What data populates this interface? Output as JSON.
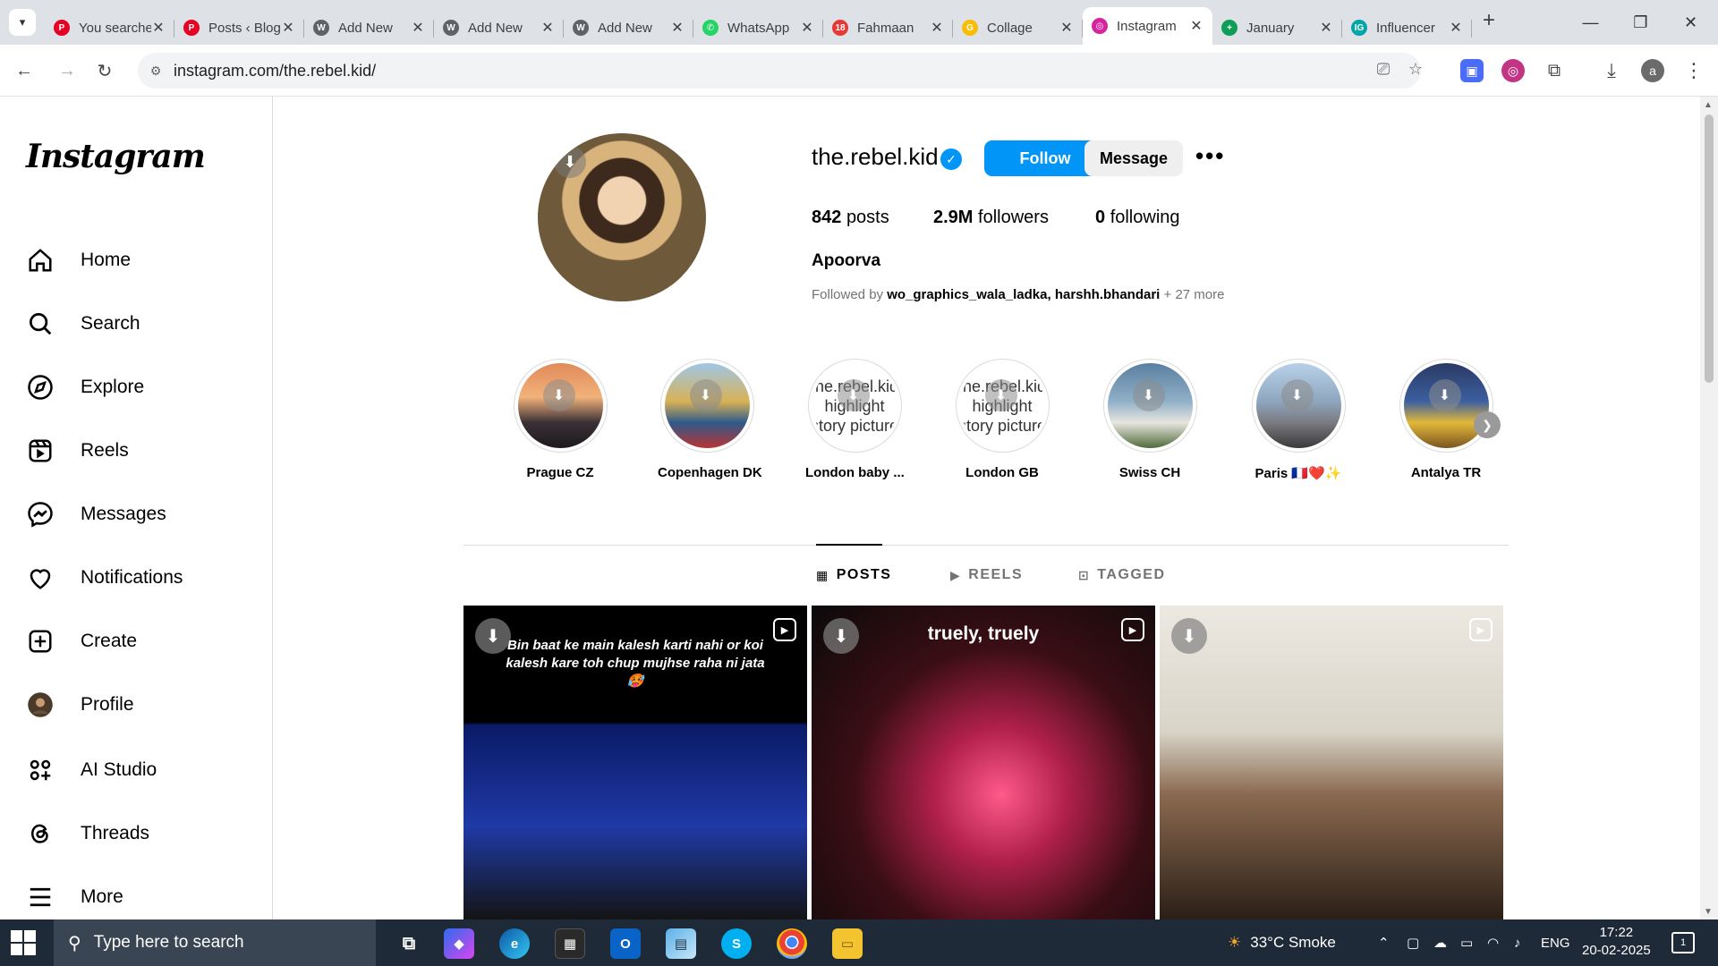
{
  "browser": {
    "tabs": [
      {
        "title": "You searched",
        "fav_color": "#e60023",
        "fav_char": "P"
      },
      {
        "title": "Posts ‹ Blog",
        "fav_color": "#e60023",
        "fav_char": "P"
      },
      {
        "title": "Add New",
        "fav_color": "#5f6368",
        "fav_char": "W"
      },
      {
        "title": "Add New",
        "fav_color": "#5f6368",
        "fav_char": "W"
      },
      {
        "title": "Add New",
        "fav_color": "#5f6368",
        "fav_char": "W"
      },
      {
        "title": "WhatsApp",
        "fav_color": "#25d366",
        "fav_char": "✆"
      },
      {
        "title": "Fahmaan",
        "fav_color": "#e53935",
        "fav_char": "18"
      },
      {
        "title": "Collage",
        "fav_color": "#fbbc04",
        "fav_char": "G"
      },
      {
        "title": "Instagram",
        "fav_color": "#d6249f",
        "fav_char": "◎",
        "active": true
      },
      {
        "title": "January",
        "fav_color": "#0f9d58",
        "fav_char": "+"
      },
      {
        "title": "Influencer",
        "fav_color": "#00a6a6",
        "fav_char": "IG"
      }
    ],
    "url": "instagram.com/the.rebel.kid/",
    "profile_initial": "a"
  },
  "sidebar": {
    "logo": "Instagram",
    "items": [
      {
        "label": "Home",
        "icon": "home-icon"
      },
      {
        "label": "Search",
        "icon": "search-icon"
      },
      {
        "label": "Explore",
        "icon": "compass-icon"
      },
      {
        "label": "Reels",
        "icon": "reels-icon"
      },
      {
        "label": "Messages",
        "icon": "messenger-icon"
      },
      {
        "label": "Notifications",
        "icon": "heart-icon"
      },
      {
        "label": "Create",
        "icon": "plus-square-icon"
      },
      {
        "label": "Profile",
        "icon": "avatar-icon"
      },
      {
        "label": "AI Studio",
        "icon": "ai-studio-icon"
      },
      {
        "label": "Threads",
        "icon": "threads-icon"
      },
      {
        "label": "More",
        "icon": "menu-icon"
      }
    ]
  },
  "profile": {
    "username": "the.rebel.kid",
    "follow_label": "Follow",
    "message_label": "Message",
    "posts_count": "842",
    "posts_label": "posts",
    "followers_count": "2.9M",
    "followers_label": "followers",
    "following_count": "0",
    "following_label": "following",
    "full_name": "Apoorva",
    "followed_by_prefix": "Followed by",
    "followed_by_user1": "wo_graphics_wala_ladka",
    "followed_by_sep": ",",
    "followed_by_user2": "harshh.bhandari",
    "followed_by_more": "+ 27 more"
  },
  "highlights": [
    {
      "label": "Prague CZ",
      "bg": "linear-gradient(180deg,#e08a5a 0%,#f2b27a 40%,#3a3036 70%,#1e1a1e 100%)"
    },
    {
      "label": "Copenhagen DK",
      "bg": "linear-gradient(180deg,#9fc6e6 0%,#d8b256 45%,#2f5a8a 70%,#b83434 100%)"
    },
    {
      "label": "London baby ...",
      "alt": "the.rebel.kid highlight story picture",
      "bg": "#ffffff"
    },
    {
      "label": "London GB",
      "alt": "the.rebel.kid highlight story picture",
      "bg": "#ffffff"
    },
    {
      "label": "Swiss CH",
      "bg": "linear-gradient(180deg,#5a7fa0 0%,#90b0c8 45%,#e8e6e0 70%,#4f6b3a 100%)"
    },
    {
      "label": "Paris 🇫🇷❤️✨",
      "bg": "linear-gradient(180deg,#b8d0e8 0%,#8ea6be 45%,#7a7a80 70%,#3a3a3a 100%)"
    },
    {
      "label": "Antalya TR",
      "bg": "linear-gradient(180deg,#2a3a64 0%,#3c5fa0 45%,#e2b83a 70%,#7a5520 100%)"
    }
  ],
  "profile_tabs": [
    {
      "label": "POSTS",
      "icon": "grid-icon",
      "active": true
    },
    {
      "label": "REELS",
      "icon": "reels-icon"
    },
    {
      "label": "TAGGED",
      "icon": "tagged-icon"
    }
  ],
  "posts": [
    {
      "caption": "Bin baat ke main kalesh karti nahi or koi kalesh kare toh chup mujhse raha ni jata 🥵",
      "bg": "linear-gradient(180deg,#000 0%,#000 37%,#0a1a66 38%,#1f3aa6 70%,#141414 100%)"
    },
    {
      "caption": "truely, truely",
      "bg": "radial-gradient(ellipse at 55% 60%,#ff5a8a 0%,#b0204a 25%,#3a0e14 55%,#0a0a0a 100%)"
    },
    {
      "caption": "",
      "bg": "linear-gradient(180deg,#ece9e2 0%,#d9d4c8 40%,#8a6a50 60%,#2a1e16 100%)"
    }
  ],
  "taskbar": {
    "search_placeholder": "Type here to search",
    "weather": "33°C Smoke",
    "language": "ENG",
    "time": "17:22",
    "date": "20-02-2025",
    "notifications_count": "1"
  }
}
